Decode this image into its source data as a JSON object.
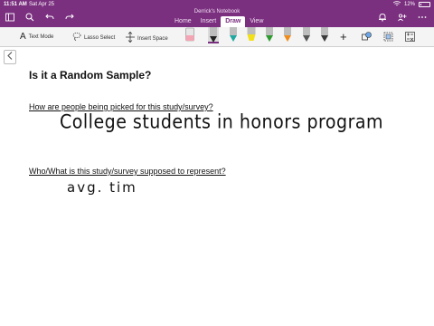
{
  "status": {
    "time": "11:51 AM",
    "date": "Sat Apr 25",
    "battery": "12%"
  },
  "window": {
    "notebook_title": "Derrick's Notebook"
  },
  "ribbon": {
    "tabs": [
      {
        "label": "Home"
      },
      {
        "label": "Insert"
      },
      {
        "label": "Draw",
        "active": true
      },
      {
        "label": "View"
      }
    ]
  },
  "toolbar": {
    "text_mode": "Text Mode",
    "lasso_select": "Lasso Select",
    "insert_space": "Insert Space",
    "pens": [
      {
        "name": "eraser",
        "color": "#f3a5b4"
      },
      {
        "name": "pen-black",
        "color": "#222222",
        "selected": true
      },
      {
        "name": "pen-teal",
        "color": "#1fa7a0"
      },
      {
        "name": "highlighter-yellow",
        "color": "#f2e01a"
      },
      {
        "name": "pen-green",
        "color": "#2f9a2f"
      },
      {
        "name": "pen-orange",
        "color": "#f08c1a"
      },
      {
        "name": "pen-gray",
        "color": "#555555"
      },
      {
        "name": "pen-darkgray",
        "color": "#3a3a3a"
      }
    ]
  },
  "page": {
    "title": "Is it a Random Sample?",
    "question1": "How are people being picked for this study/survey?",
    "answer1_ink": "College students in honors program",
    "question2": "Who/What is this study/survey supposed to represent?",
    "answer2_ink": "avg. tim"
  },
  "colors": {
    "accent": "#7a2f7f"
  }
}
